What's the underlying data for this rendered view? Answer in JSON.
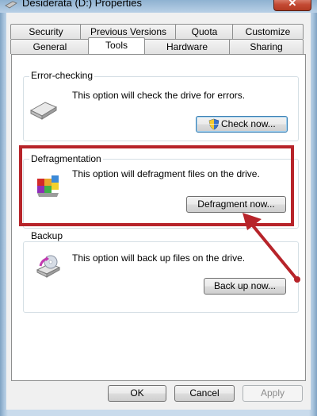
{
  "window": {
    "title": "Desiderata (D:) Properties",
    "close_glyph": "✕"
  },
  "tabs_row1": [
    "Security",
    "Previous Versions",
    "Quota",
    "Customize"
  ],
  "tabs_row2": [
    "General",
    "Tools",
    "Hardware",
    "Sharing"
  ],
  "active_tab": "Tools",
  "error_checking": {
    "label": "Error-checking",
    "description": "This option will check the drive for errors.",
    "button": "Check now...",
    "icon": "hard-drive-icon"
  },
  "defragmentation": {
    "label": "Defragmentation",
    "description": "This option will defragment files on the drive.",
    "button": "Defragment now...",
    "icon": "defragment-icon"
  },
  "backup": {
    "label": "Backup",
    "description": "This option will back up files on the drive.",
    "button": "Back up now...",
    "icon": "backup-icon"
  },
  "footer": {
    "ok": "OK",
    "cancel": "Cancel",
    "apply": "Apply"
  },
  "annotation": {
    "color": "#b7242a"
  }
}
